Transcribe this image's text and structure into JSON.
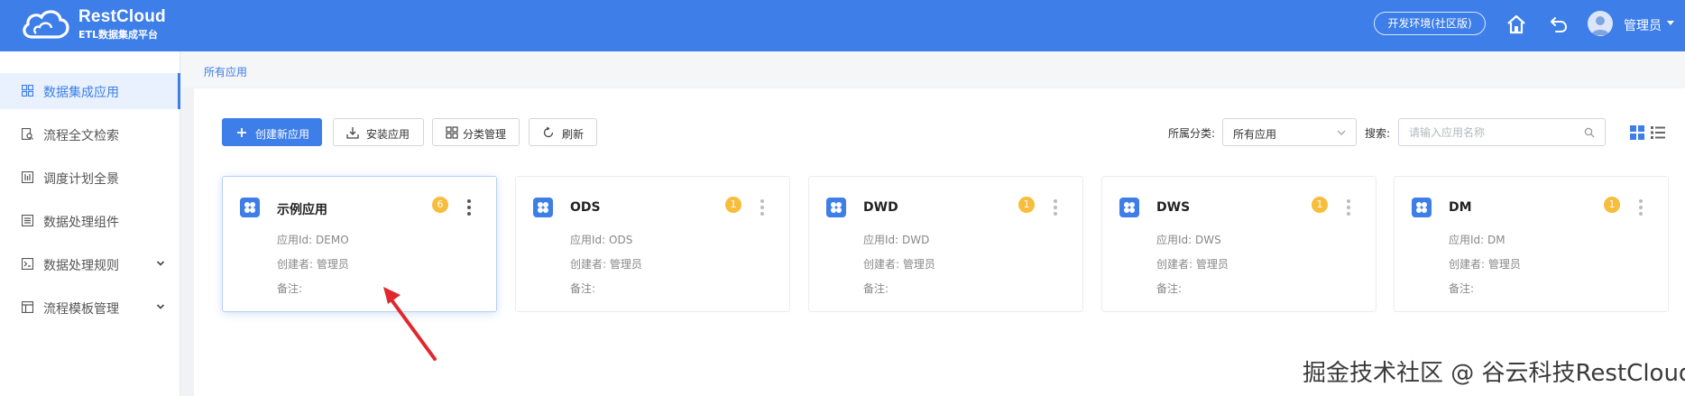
{
  "header": {
    "brand_title": "RestCloud",
    "brand_subtitle": "ETL数据集成平台",
    "env_label": "开发环境(社区版)",
    "user_name": "管理员",
    "icons": [
      "home-icon",
      "back-icon",
      "avatar",
      "caret-down-icon"
    ],
    "bg_color": "#3d7ee8"
  },
  "sidebar": {
    "items": [
      {
        "label": "数据集成应用",
        "icon": "grid-icon",
        "active": true,
        "expandable": false
      },
      {
        "label": "流程全文检索",
        "icon": "search-doc-icon",
        "active": false,
        "expandable": false
      },
      {
        "label": "调度计划全景",
        "icon": "schedule-icon",
        "active": false,
        "expandable": false
      },
      {
        "label": "数据处理组件",
        "icon": "component-icon",
        "active": false,
        "expandable": false
      },
      {
        "label": "数据处理规则",
        "icon": "terminal-icon",
        "active": false,
        "expandable": true
      },
      {
        "label": "流程模板管理",
        "icon": "template-icon",
        "active": false,
        "expandable": true
      }
    ]
  },
  "breadcrumb": {
    "label": "所有应用"
  },
  "toolbar": {
    "create_label": "创建新应用",
    "install_label": "安装应用",
    "category_label": "分类管理",
    "refresh_label": "刷新",
    "category_filter_label": "所属分类:",
    "category_filter_value": "所有应用",
    "search_label": "搜索:",
    "search_placeholder": "请输入应用名称",
    "search_value": ""
  },
  "cards": [
    {
      "title": "示例应用",
      "badge": "6",
      "app_id": "应用Id: DEMO",
      "creator": "创建者: 管理员",
      "note": "备注:",
      "highlighted": true
    },
    {
      "title": "ODS",
      "badge": "1",
      "app_id": "应用Id: ODS",
      "creator": "创建者: 管理员",
      "note": "备注:",
      "highlighted": false
    },
    {
      "title": "DWD",
      "badge": "1",
      "app_id": "应用Id: DWD",
      "creator": "创建者: 管理员",
      "note": "备注:",
      "highlighted": false
    },
    {
      "title": "DWS",
      "badge": "1",
      "app_id": "应用Id: DWS",
      "creator": "创建者: 管理员",
      "note": "备注:",
      "highlighted": false
    },
    {
      "title": "DM",
      "badge": "1",
      "app_id": "应用Id: DM",
      "creator": "创建者: 管理员",
      "note": "备注:",
      "highlighted": false
    }
  ],
  "watermark": "掘金技术社区 @ 谷云科技RestCloud",
  "colors": {
    "accent": "#3d7ee8",
    "badge": "#f7bd3b",
    "arrow": "#e0282e"
  }
}
